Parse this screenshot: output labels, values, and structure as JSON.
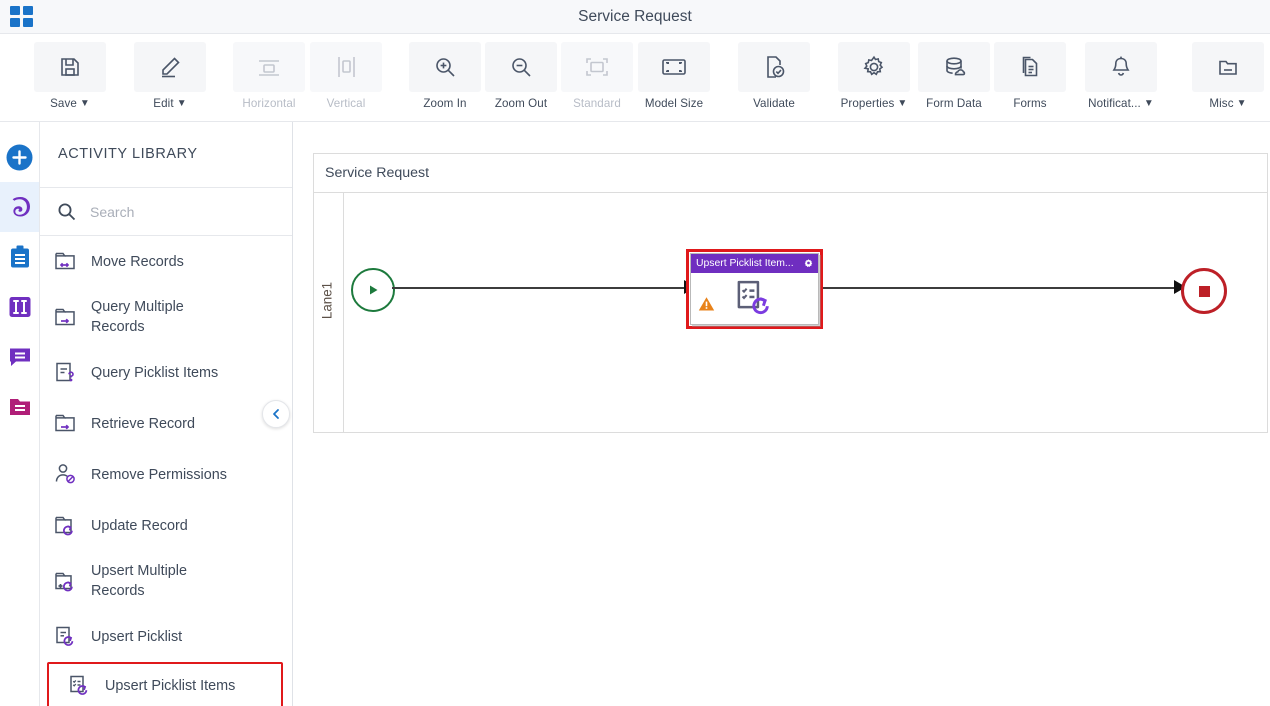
{
  "window": {
    "title": "Service Request",
    "logo_icon": "app-grid-icon"
  },
  "toolbar": {
    "items": [
      {
        "label": "Save",
        "icon": "save-floppy-icon",
        "caret": "⌄",
        "disabled": false
      },
      {
        "label": "Edit",
        "icon": "pencil-edit-icon",
        "caret": "⌄",
        "disabled": false
      },
      {
        "label": "Horizontal",
        "icon": "horizontal-layout-icon",
        "caret": "",
        "disabled": true
      },
      {
        "label": "Vertical",
        "icon": "vertical-layout-icon",
        "caret": "",
        "disabled": true
      },
      {
        "label": "Zoom In",
        "icon": "zoom-in-icon",
        "caret": "",
        "disabled": false
      },
      {
        "label": "Zoom Out",
        "icon": "zoom-out-icon",
        "caret": "",
        "disabled": false
      },
      {
        "label": "Standard",
        "icon": "standard-size-icon",
        "caret": "",
        "disabled": true
      },
      {
        "label": "Model Size",
        "icon": "model-size-icon",
        "caret": "",
        "disabled": false
      },
      {
        "label": "Validate",
        "icon": "validate-check-icon",
        "caret": "",
        "disabled": false
      },
      {
        "label": "Properties",
        "icon": "gear-icon",
        "caret": "⌄",
        "disabled": false
      },
      {
        "label": "Form Data",
        "icon": "database-icon",
        "caret": "",
        "disabled": false
      },
      {
        "label": "Forms",
        "icon": "forms-document-icon",
        "caret": "",
        "disabled": false
      },
      {
        "label": "Notificat...",
        "icon": "bell-icon",
        "caret": "⌄",
        "disabled": false
      },
      {
        "label": "Misc",
        "icon": "folder-misc-icon",
        "caret": "⌄",
        "disabled": false
      }
    ]
  },
  "rail": {
    "items": [
      {
        "name": "add-icon",
        "color": "#1a73c8",
        "active": false
      },
      {
        "name": "activity-icon",
        "color": "#7030c0",
        "active": true
      },
      {
        "name": "clipboard-icon",
        "color": "#1a73c8",
        "active": false
      },
      {
        "name": "columns-icon",
        "color": "#7030c0",
        "active": false
      },
      {
        "name": "comment-icon",
        "color": "#7030c0",
        "active": false
      },
      {
        "name": "folder-icon",
        "color": "#b01e78",
        "active": false
      }
    ]
  },
  "library": {
    "title": "ACTIVITY LIBRARY",
    "search": {
      "value": "",
      "placeholder": "Search",
      "icon": "search-icon"
    },
    "collapse_icon": "chevron-left-icon",
    "items": [
      {
        "label": "Move Records",
        "icon": "folder-move-icon",
        "selected": false,
        "two_line": false
      },
      {
        "label": "Query Multiple Records",
        "icon": "folder-arrow-icon",
        "selected": false,
        "two_line": true
      },
      {
        "label": "Query Picklist Items",
        "icon": "list-question-icon",
        "selected": false,
        "two_line": false
      },
      {
        "label": "Retrieve Record",
        "icon": "folder-arrow-icon",
        "selected": false,
        "two_line": false
      },
      {
        "label": "Remove Permissions",
        "icon": "user-remove-icon",
        "selected": false,
        "two_line": false
      },
      {
        "label": "Update Record",
        "icon": "folder-refresh-icon",
        "selected": false,
        "two_line": false
      },
      {
        "label": "Upsert Multiple Records",
        "icon": "folder-plus-refresh-icon",
        "selected": false,
        "two_line": true
      },
      {
        "label": "Upsert Picklist",
        "icon": "list-refresh-icon",
        "selected": false,
        "two_line": false
      },
      {
        "label": "Upsert Picklist Items",
        "icon": "checklist-refresh-icon",
        "selected": true,
        "two_line": false
      }
    ]
  },
  "canvas": {
    "pool_title": "Service Request",
    "lane_label": "Lane1",
    "start_event": {
      "name": "start-event",
      "icon": "play-triangle-icon",
      "color": "#1d7a3d"
    },
    "end_event": {
      "name": "end-event",
      "icon": "stop-square-icon",
      "color": "#bd2027"
    },
    "task": {
      "title": "Upsert Picklist Item...",
      "header_color": "#6f2ec0",
      "selection_color": "#e0191b",
      "gear_icon": "gear-icon",
      "body_icon": "checklist-refresh-icon",
      "warning_icon": "warning-triangle-icon",
      "warning_color": "#e8821a"
    }
  }
}
